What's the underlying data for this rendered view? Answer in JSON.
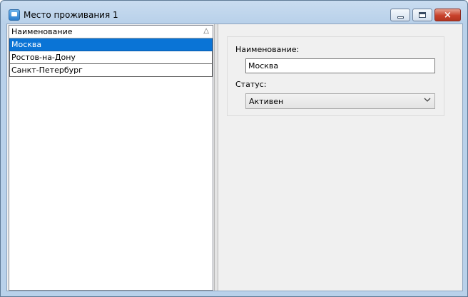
{
  "window": {
    "title": "Место проживания 1",
    "buttons": {
      "minimize": "minimize",
      "maximize": "maximize",
      "close": "×"
    }
  },
  "list": {
    "column_header": "Наименование",
    "sort_indicator": "△",
    "rows": [
      {
        "label": "Москва",
        "selected": true
      },
      {
        "label": "Ростов-на-Дону",
        "selected": false
      },
      {
        "label": "Санкт-Петербург",
        "selected": false
      }
    ]
  },
  "form": {
    "name_label": "Наименование:",
    "name_value": "Москва",
    "status_label": "Статус:",
    "status_value": "Активен",
    "dropdown_icon": "chevron-down-icon"
  },
  "colors": {
    "selection": "#0a74d6",
    "close_button": "#c8412b",
    "client_background": "#f0f0f0"
  }
}
